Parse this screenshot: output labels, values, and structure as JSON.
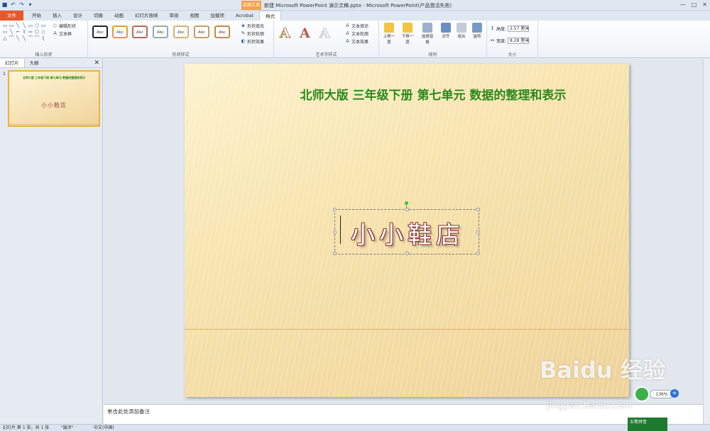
{
  "window": {
    "title": "新建 Microsoft PowerPoint 演示文稿.pptx - Microsoft PowerPoint(产品激活失败)",
    "context_tab": "绘图工具",
    "controls": [
      "—",
      "□",
      "✕"
    ]
  },
  "qat": {
    "save_icon": "■",
    "undo_icon": "↶",
    "redo_icon": "↷",
    "more_icon": "▾"
  },
  "tabs": [
    {
      "label": "文件"
    },
    {
      "label": "开始"
    },
    {
      "label": "插入"
    },
    {
      "label": "设计"
    },
    {
      "label": "切换"
    },
    {
      "label": "动画"
    },
    {
      "label": "幻灯片放映"
    },
    {
      "label": "审阅"
    },
    {
      "label": "视图"
    },
    {
      "label": "加载项"
    },
    {
      "label": "Acrobat"
    },
    {
      "label": "格式"
    }
  ],
  "ribbon": {
    "insert_shapes": {
      "label": "插入形状",
      "edit_shape": "编辑形状",
      "textbox": "文本框",
      "shape_glyphs": [
        "▭",
        "▭",
        "╲",
        "╲",
        "▭",
        "○",
        "▭",
        "▭",
        "╲",
        "⌐",
        "⇧",
        "⇨",
        "⬠",
        "◇",
        "△",
        "⌒",
        "╲",
        "╲",
        "⌒",
        "⌒",
        "{"
      ]
    },
    "shape_styles": {
      "label": "形状样式",
      "preset_label": "Abc",
      "fill": "形状填充",
      "outline": "形状轮廓",
      "effects": "形状效果"
    },
    "wordart_styles": {
      "label": "艺术字样式",
      "glyph": "A",
      "text_fill": "文本填充",
      "text_outline": "文本轮廓",
      "text_effects": "文本效果"
    },
    "arrange": {
      "label": "排列",
      "bring_forward": "上移一层",
      "send_backward": "下移一层",
      "selection_pane": "选择窗格",
      "align": "对齐",
      "group": "组合",
      "rotate": "旋转"
    },
    "size": {
      "label": "大小",
      "height_label": "高度:",
      "height_value": "2.57 厘米",
      "width_label": "宽度:",
      "width_value": "8.28 厘米"
    }
  },
  "left_pane": {
    "tab_slides": "幻灯片",
    "tab_outline": "大纲",
    "close": "✕",
    "thumb_number": "1"
  },
  "slide": {
    "title": "北师大版  三年级下册  第七单元  数据的整理和表示",
    "wordart": "小小鞋店",
    "title_color": "#2a8a1a",
    "wordart_outline_color": "#8a2a2a"
  },
  "notes": {
    "placeholder": "单击此处添加备注"
  },
  "status": {
    "slide_info": "幻灯片 第 1 张，共 1 张",
    "theme": "\"跋涉\"",
    "language": "中文(中国)"
  },
  "overlay": {
    "ime_label": "五笔拼音",
    "watermark": "Baidu 经验",
    "watermark_url": "jingyan.baidu.com",
    "zoom_pill": "136%",
    "zoom_plus": "+"
  }
}
